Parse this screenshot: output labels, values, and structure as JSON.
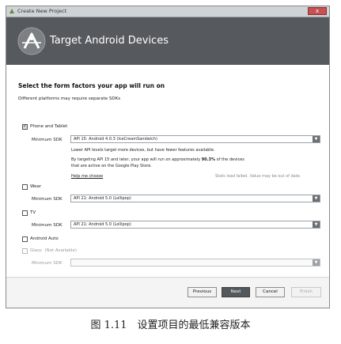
{
  "window": {
    "title": "Create New Project",
    "close_glyph": "x"
  },
  "banner": {
    "heading": "Target Android Devices",
    "logo_icon": "android-studio-logo-icon"
  },
  "section": {
    "heading": "Select the form factors your app will run on",
    "subheading": "Different platforms may require separate SDKs"
  },
  "phone_tablet": {
    "label": "Phone and Tablet",
    "checked": true,
    "min_sdk_label": "Minimum SDK",
    "min_sdk_value": "API 15: Android 4.0.3 (IceCreamSandwich)",
    "info_line1": "Lower API levels target more devices, but have fewer features available.",
    "info_line2_prefix": "By targeting API 15 and later, your app will run on approximately ",
    "info_line2_bold": "90.3%",
    "info_line2_suffix": " of the devices",
    "info_line3": "that are active on the Google Play Store.",
    "help_link": "Help me choose",
    "stats_note": "Stats load failed. Value may be out of date."
  },
  "wear": {
    "label": "Wear",
    "checked": false,
    "min_sdk_label": "Minimum SDK",
    "min_sdk_value": "API 21: Android 5.0 (Lollipop)"
  },
  "tv": {
    "label": "TV",
    "checked": false,
    "min_sdk_label": "Minimum SDK",
    "min_sdk_value": "API 21: Android 5.0 (Lollipop)"
  },
  "auto": {
    "label": "Android Auto",
    "checked": false
  },
  "glass": {
    "label": "Glass",
    "note": "(Not Available)",
    "checked": false,
    "min_sdk_label": "Minimum SDK",
    "min_sdk_value": ""
  },
  "footer": {
    "previous": "Previous",
    "next": "Next",
    "cancel": "Cancel",
    "finish": "Finish"
  },
  "caption": "图 1.11　设置项目的最低兼容版本",
  "colors": {
    "banner": "#565a5e",
    "primary_button": "#53585c"
  }
}
